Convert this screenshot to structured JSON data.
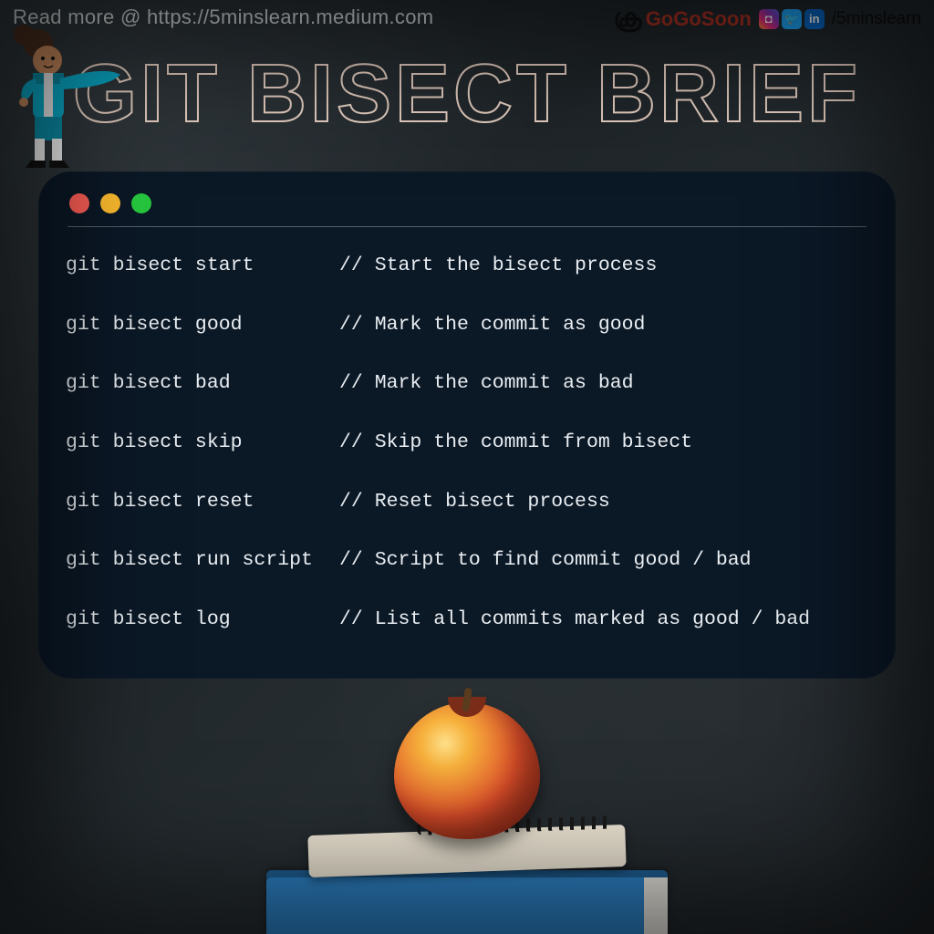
{
  "header": {
    "readmore": "Read more @ https://5minslearn.medium.com",
    "brand_text": "GoGoSoon",
    "handle": "/5minslearn",
    "social": {
      "instagram": "◘",
      "twitter": "🐦",
      "linkedin": "in"
    }
  },
  "title": "GIT BISECT BRIEF",
  "terminal": {
    "rows": [
      {
        "cmd": "git bisect start",
        "desc": "// Start the bisect process"
      },
      {
        "cmd": "git bisect good",
        "desc": "// Mark the commit as good"
      },
      {
        "cmd": "git bisect bad",
        "desc": "// Mark the commit as bad"
      },
      {
        "cmd": "git bisect skip",
        "desc": "// Skip the commit from bisect"
      },
      {
        "cmd": "git bisect reset",
        "desc": "// Reset bisect process"
      },
      {
        "cmd": "git bisect run script",
        "desc": "// Script to find commit good / bad"
      },
      {
        "cmd": "git bisect log",
        "desc": "// List all commits marked as good / bad"
      }
    ]
  },
  "colors": {
    "title_stroke": "#e6cfc1",
    "terminal_bg": "#0b1826",
    "dot_red": "#ff5f56",
    "dot_yellow": "#ffbd2e",
    "dot_green": "#27c93f"
  }
}
